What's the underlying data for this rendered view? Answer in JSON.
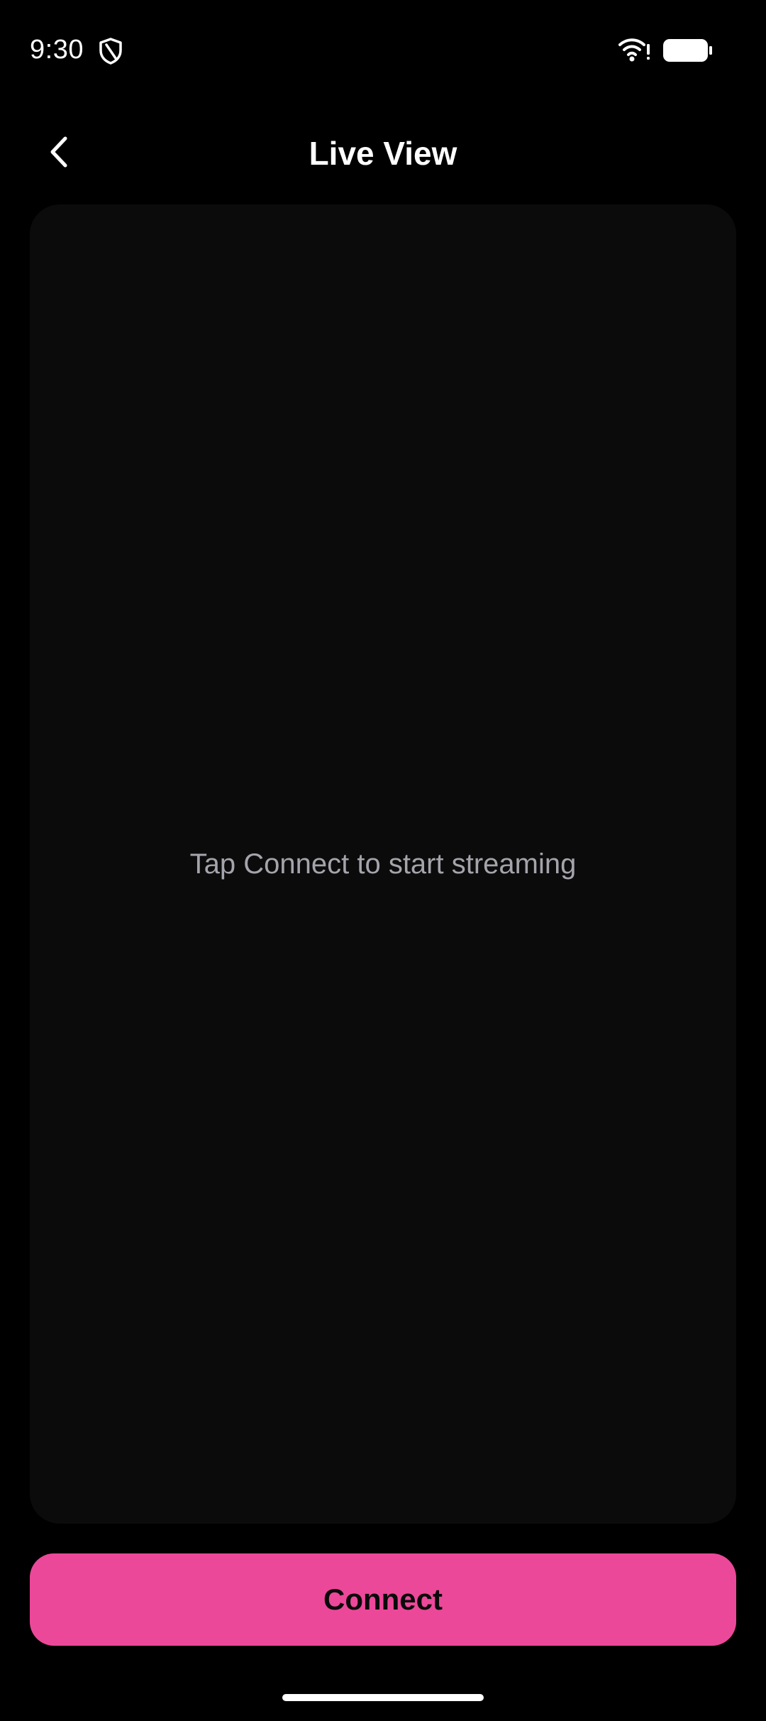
{
  "status_bar": {
    "time": "9:30",
    "icons": [
      "shield-icon",
      "wifi-alert-icon",
      "battery-icon"
    ]
  },
  "app_bar": {
    "back_icon": "chevron-left-icon",
    "title": "Live View"
  },
  "stream_panel": {
    "placeholder": "Tap Connect to start streaming"
  },
  "actions": {
    "connect_label": "Connect"
  },
  "colors": {
    "background": "#000000",
    "panel": "#0b0b0b",
    "accent": "#ec4899",
    "placeholder_text": "#a4a4ac"
  }
}
